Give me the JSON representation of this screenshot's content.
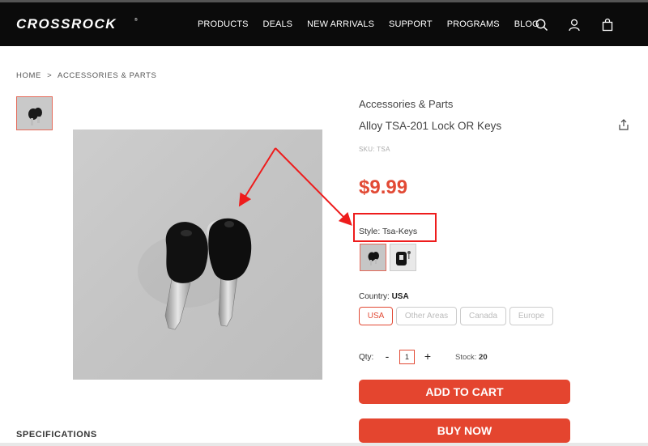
{
  "header": {
    "logo_text": "CROSSROCK",
    "nav": [
      "PRODUCTS",
      "DEALS",
      "NEW ARRIVALS",
      "SUPPORT",
      "PROGRAMS",
      "BLOG"
    ],
    "icons": [
      "search-icon",
      "user-icon",
      "cart-icon"
    ]
  },
  "breadcrumb": {
    "home": "HOME",
    "separator": ">",
    "current": "ACCESSORIES & PARTS"
  },
  "product": {
    "category": "Accessories & Parts",
    "title": "Alloy TSA-201 Lock OR Keys",
    "sku": "SKU: TSA",
    "price": "$9.99",
    "style_label": "Style:",
    "style_value": "Tsa-Keys",
    "country_label": "Country:",
    "country_value": "USA",
    "country_options": [
      "USA",
      "Other Areas",
      "Canada",
      "Europe"
    ],
    "qty_label": "Qty:",
    "qty_minus": "-",
    "qty_value": "1",
    "qty_plus": "+",
    "stock_label": "Stock:",
    "stock_value": "20",
    "add_to_cart": "ADD TO CART",
    "buy_now": "BUY NOW"
  },
  "specifications_heading": "SPECIFICATIONS",
  "colors": {
    "accent": "#e4452f",
    "annotation": "#ee1c1c",
    "header_bg": "#0b0b0b"
  }
}
